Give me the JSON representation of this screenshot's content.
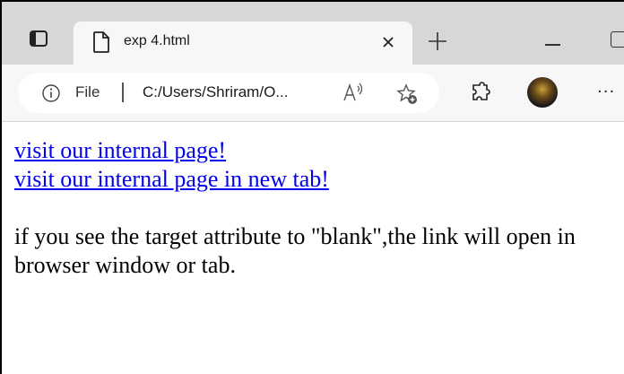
{
  "browser": {
    "tab": {
      "title": "exp 4.html"
    },
    "address_bar": {
      "scheme_label": "File",
      "url": "C:/Users/Shriram/O..."
    },
    "icons": {
      "tab_actions": "tab-actions-icon",
      "page": "page-icon",
      "close": "close-icon",
      "new_tab": "plus-icon",
      "info": "info-icon",
      "read_aloud": "read-aloud-icon",
      "add_favorite": "add-favorite-icon",
      "extensions": "puzzle-icon",
      "profile": "profile-avatar",
      "more": "more-icon"
    },
    "more_glyph": "···"
  },
  "page": {
    "link1": "visit our internal page!",
    "link2": "visit our internal page in new tab!",
    "paragraph": "if you see the target attribute to \"blank\",the link will open in browser window or tab."
  },
  "colors": {
    "link": "#0000ee",
    "tabstrip": "#d7d7d7",
    "toolbar": "#f7f7f7"
  }
}
